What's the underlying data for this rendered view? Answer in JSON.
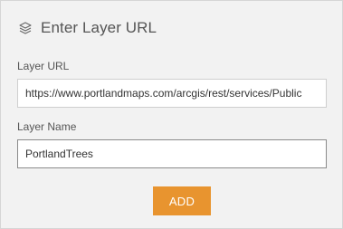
{
  "header": {
    "title": "Enter Layer URL",
    "icon": "layers-icon"
  },
  "form": {
    "layer_url": {
      "label": "Layer URL",
      "value": "https://www.portlandmaps.com/arcgis/rest/services/Public"
    },
    "layer_name": {
      "label": "Layer Name",
      "value": "PortlandTrees"
    },
    "add_button": {
      "label": "ADD"
    }
  },
  "colors": {
    "accent": "#e8942f",
    "panel_background": "#f2f2f2",
    "text": "#555555"
  }
}
